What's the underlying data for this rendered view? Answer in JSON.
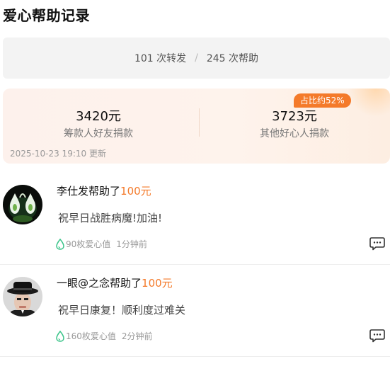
{
  "page": {
    "title": "爱心帮助记录"
  },
  "stats": {
    "shares": "101 次转发",
    "separator": "/",
    "helps": "245 次帮助"
  },
  "funds": {
    "ratio_badge": "占比约52%",
    "organizer_amount": "3420元",
    "organizer_label": "筹款人好友捐款",
    "others_amount": "3723元",
    "others_label": "其他好心人捐款",
    "update_time": "2025-10-23 19:10 更新"
  },
  "records": [
    {
      "name": "李仕发",
      "action": "帮助了",
      "amount": "100元",
      "message": "祝早日战胜病魔!加油!",
      "love_value": "90枚爱心值",
      "time": "1分钟前",
      "avatar_icon": "avatar-twin-figures-icon"
    },
    {
      "name": "一眼@之念",
      "action": "帮助了",
      "amount": "100元",
      "message": "祝早日康复！顺利度过难关",
      "love_value": "160枚爱心值",
      "time": "2分钟前",
      "avatar_icon": "avatar-hat-man-icon"
    }
  ],
  "colors": {
    "accent": "#f47a2a",
    "drop_green": "#3cc48a"
  }
}
